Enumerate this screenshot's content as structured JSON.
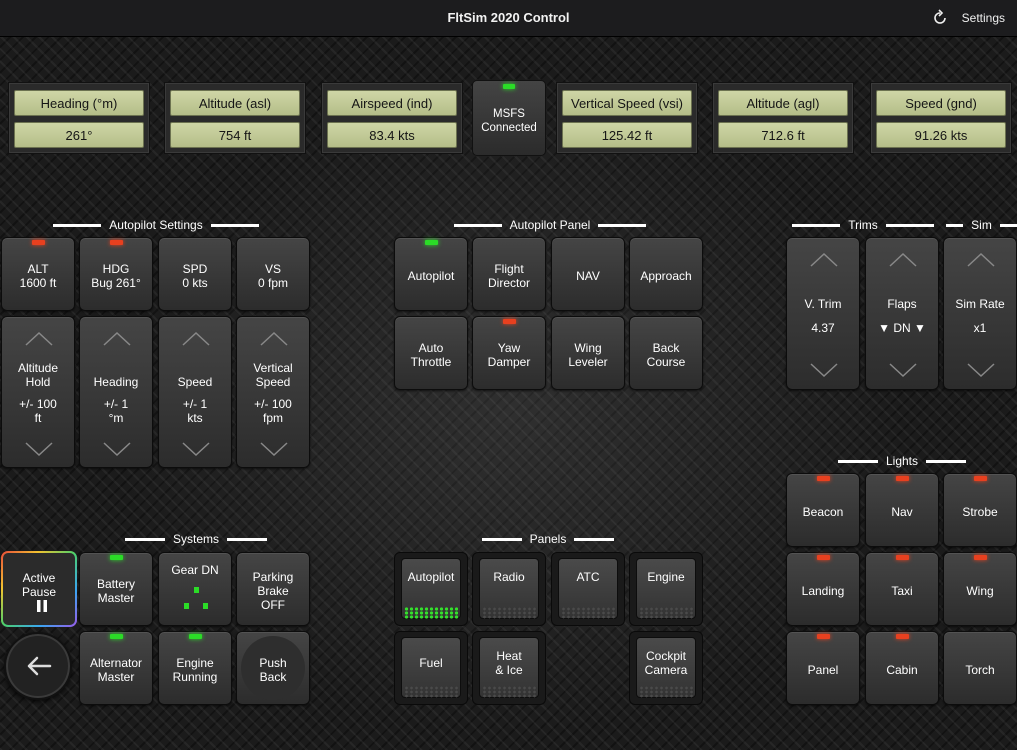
{
  "header": {
    "title": "FltSim 2020 Control",
    "settings_label": "Settings",
    "refresh_icon": "refresh-icon"
  },
  "gauges": [
    {
      "label": "Heading (°m)",
      "value": "261°"
    },
    {
      "label": "Altitude (asl)",
      "value": "754 ft"
    },
    {
      "label": "Airspeed (ind)",
      "value": "83.4 kts"
    },
    {
      "label": "Vertical Speed (vsi)",
      "value": "125.42 ft"
    },
    {
      "label": "Altitude (agl)",
      "value": "712.6 ft"
    },
    {
      "label": "Speed (gnd)",
      "value": "91.26 kts"
    }
  ],
  "msfs": {
    "line1": "MSFS",
    "line2": "Connected",
    "status_color": "#2bdc27"
  },
  "sections": {
    "autopilot_settings": "Autopilot Settings",
    "autopilot_panel": "Autopilot Panel",
    "trims": "Trims",
    "sim": "Sim",
    "lights": "Lights",
    "systems": "Systems",
    "panels": "Panels"
  },
  "ap_settings": {
    "top": [
      {
        "l1": "ALT",
        "l2": "1600 ft",
        "led": "red"
      },
      {
        "l1": "HDG",
        "l2": "Bug 261°",
        "led": "red"
      },
      {
        "l1": "SPD",
        "l2": "0 kts",
        "led": ""
      },
      {
        "l1": "VS",
        "l2": "0 fpm",
        "led": ""
      }
    ],
    "steppers": [
      {
        "l1": "Altitude",
        "l2": "Hold",
        "l3": "+/- 100",
        "l4": "ft"
      },
      {
        "l1": "Heading",
        "l2": "",
        "l3": "+/- 1",
        "l4": "°m"
      },
      {
        "l1": "Speed",
        "l2": "",
        "l3": "+/- 1",
        "l4": "kts"
      },
      {
        "l1": "Vertical",
        "l2": "Speed",
        "l3": "+/- 100",
        "l4": "fpm"
      }
    ]
  },
  "ap_panel": [
    {
      "l1": "Autopilot",
      "l2": "",
      "led": "green"
    },
    {
      "l1": "Flight",
      "l2": "Director",
      "led": ""
    },
    {
      "l1": "NAV",
      "l2": "",
      "led": ""
    },
    {
      "l1": "Approach",
      "l2": "",
      "led": ""
    },
    {
      "l1": "Auto",
      "l2": "Throttle",
      "led": ""
    },
    {
      "l1": "Yaw",
      "l2": "Damper",
      "led": "red"
    },
    {
      "l1": "Wing",
      "l2": "Leveler",
      "led": ""
    },
    {
      "l1": "Back",
      "l2": "Course",
      "led": ""
    }
  ],
  "trims": [
    {
      "label": "V. Trim",
      "value": "4.37"
    },
    {
      "label": "Flaps",
      "value": "▼ DN ▼"
    },
    {
      "label": "Sim Rate",
      "value": "x1"
    }
  ],
  "lights": [
    "Beacon",
    "Nav",
    "Strobe",
    "Landing",
    "Taxi",
    "Wing",
    "Panel",
    "Cabin",
    "Torch"
  ],
  "systems": {
    "active_pause": "Active\nPause",
    "active_pause_l1": "Active",
    "active_pause_l2": "Pause",
    "battery": {
      "l1": "Battery",
      "l2": "Master"
    },
    "gear": {
      "l1": "Gear DN"
    },
    "parking": {
      "l1": "Parking",
      "l2": "Brake",
      "l3": "OFF"
    },
    "alternator": {
      "l1": "Alternator",
      "l2": "Master"
    },
    "engine": {
      "l1": "Engine",
      "l2": "Running"
    },
    "pushback": {
      "l1": "Push",
      "l2": "Back"
    }
  },
  "panels": [
    {
      "l1": "Autopilot",
      "l2": "",
      "active": true
    },
    {
      "l1": "Radio",
      "l2": "",
      "active": false
    },
    {
      "l1": "ATC",
      "l2": "",
      "active": false
    },
    {
      "l1": "Engine",
      "l2": "",
      "active": false
    },
    {
      "l1": "Fuel",
      "l2": "",
      "active": false
    },
    {
      "l1": "Heat",
      "l2": "& Ice",
      "active": false
    },
    {
      "l1": "Cockpit",
      "l2": "Camera",
      "active": false
    }
  ],
  "colors": {
    "led_red": "#e8401f",
    "led_green": "#2bdc27",
    "gauge_bg": "#c4cb97"
  }
}
